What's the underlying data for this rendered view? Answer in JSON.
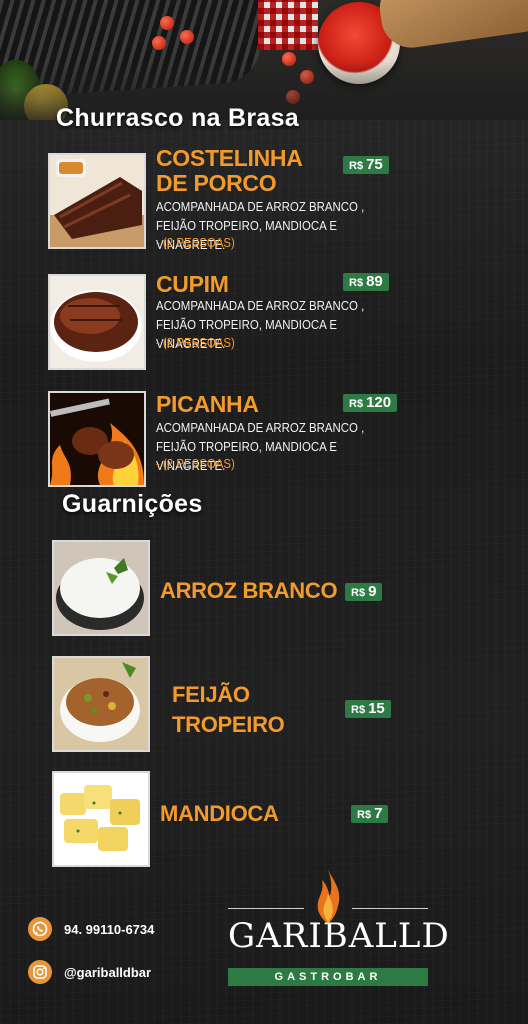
{
  "sections": {
    "churrasco_title": "Churrasco na Brasa",
    "guarnicoes_title": "Guarnições"
  },
  "churrasco": [
    {
      "name": "COSTELINHA\nDE PORCO",
      "description": "ACOMPANHADA DE ARROZ BRANCO , FEIJÃO TROPEIRO, MANDIOCA E VINAGRETE.",
      "serves": "- (2 PESSOAS)",
      "currency": "R$",
      "price": "75",
      "photo_icon": "ribs-photo"
    },
    {
      "name": "CUPIM",
      "description": "ACOMPANHADA DE ARROZ BRANCO , FEIJÃO TROPEIRO, MANDIOCA E VINAGRETE.",
      "serves": "- (2 PESSOAS)",
      "currency": "R$",
      "price": "89",
      "photo_icon": "roast-beef-photo"
    },
    {
      "name": "PICANHA",
      "description": "ACOMPANHADA DE ARROZ BRANCO , FEIJÃO TROPEIRO, MANDIOCA E VINAGRETE.",
      "serves": "- (2 PESSOAS)",
      "currency": "R$",
      "price": "120",
      "photo_icon": "picanha-skewer-photo"
    }
  ],
  "guarnicoes": [
    {
      "name": "ARROZ BRANCO",
      "currency": "R$",
      "price": "9",
      "photo_icon": "rice-photo"
    },
    {
      "name": "FEIJÃO\nTROPEIRO",
      "currency": "R$",
      "price": "15",
      "photo_icon": "beans-photo"
    },
    {
      "name": "MANDIOCA",
      "currency": "R$",
      "price": "7",
      "photo_icon": "cassava-photo"
    }
  ],
  "contact": {
    "phone": "94. 99110-6734",
    "instagram": "@gariballdbar",
    "phone_icon": "whatsapp-icon",
    "instagram_icon": "instagram-icon"
  },
  "brand": {
    "name": "GARIBALLD",
    "tagline": "GASTROBAR",
    "icon": "flame-icon"
  },
  "colors": {
    "accent_orange": "#f29a2c",
    "price_green": "#2e7a45",
    "background": "#1c1c1c"
  }
}
